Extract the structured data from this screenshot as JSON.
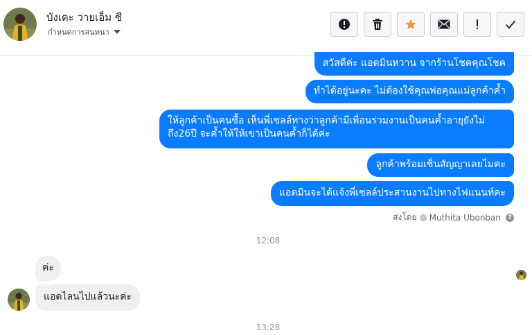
{
  "header": {
    "contact_name": "บังเดะ วายเอ็ม ซี",
    "subtitle": "กำหนดการสนทนา",
    "toolbar": [
      {
        "name": "report-button",
        "icon": "alert-circle-icon"
      },
      {
        "name": "delete-button",
        "icon": "trash-icon"
      },
      {
        "name": "star-button",
        "icon": "star-icon",
        "color": "#f7923b"
      },
      {
        "name": "mark-unread-button",
        "icon": "envelope-icon"
      },
      {
        "name": "flag-button",
        "icon": "exclamation-icon"
      },
      {
        "name": "mark-done-button",
        "icon": "check-icon"
      }
    ]
  },
  "messages": {
    "outgoing": [
      "สวัสดีค่ะ แอดมินหวาน จากร้านโชคคุณโชค",
      "ทำได้อยู่นะคะ ไม่ต้องใช้คุณพ่อคุณแม่ลูกค้าค้ำ",
      "ให้ลูกค้าเป็นคนซื้อ เห็นพี่เซลล์ทางว่าลูกค้ามีเพื่อนร่วมงานเป็นคนค้ำอายุยังไม่ถึง26ปี จะค้ำให้ให้เขาเป็นคนค้ำก็ได้ค่ะ",
      "ลูกค้าพร้อมเซ็นสัญญาเลยไมคะ",
      "แอดมินจะได้แจ้งพี่เซลล์ประสานงานไปทางไฟแนนท์คะ"
    ],
    "sent_by_label": "ส่งโดย",
    "sent_by_name": "Muthita Ubonban",
    "time_1": "12:08",
    "incoming": [
      "ค่ะ",
      "แอดไลนไปแล้วนะค่ะ"
    ],
    "time_2": "13:28"
  },
  "colors": {
    "outgoing_bubble": "#0a7cff",
    "incoming_bubble": "#f1f0f0",
    "star": "#f7923b"
  }
}
